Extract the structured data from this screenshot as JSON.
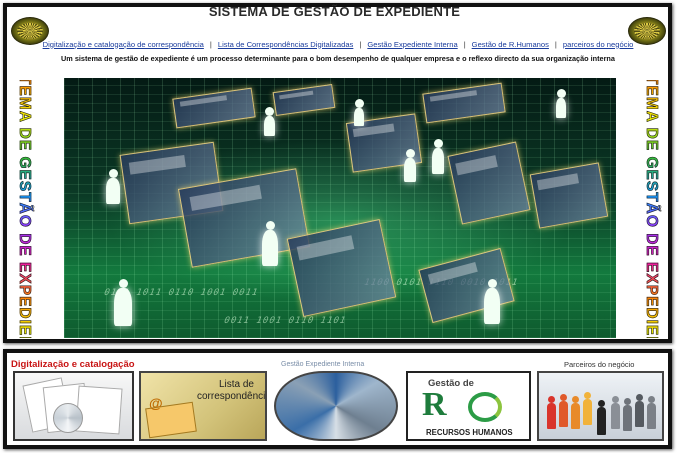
{
  "header": {
    "title": "SISTEMA DE GESTÃO DE EXPEDIENTE",
    "tagline": "Um sistema de gestão de expediente é um processo determinante para o bom desempenho de qualquer empresa e o reflexo directo da sua organização interna"
  },
  "nav": {
    "items": [
      {
        "label": "Digitalização e catalogação de correspondência"
      },
      {
        "label": "Lista de Correspondências Digitalizadas"
      },
      {
        "label": "Gestão Expediente Interna"
      },
      {
        "label": "Gestão de R.Humanos"
      },
      {
        "label": "parceiros do negócio"
      }
    ],
    "separator": "|"
  },
  "side_banner": {
    "text": "SISTEMA DE GESTÃO DE EXPEDIENTE"
  },
  "tiles": {
    "digitalizacao_label": "Digitalização e catalogação",
    "lista_text_1": "Lista de",
    "lista_text_2": "correspondências",
    "gestao_label": "Gestão Expediente Interna",
    "rh_gestao": "Gestão de",
    "rh_letters": "R",
    "rh_caption": "RECURSOS HUMANOS",
    "parceiros_label": "Parceiros do negócio"
  },
  "colors": {
    "nav_link": "#1a3c9c",
    "digitalizacao_label": "#c81414",
    "rh_green": "#1e7c3c",
    "hero_green": "#137a3e"
  },
  "icons": {
    "logo": "olive-emblem-icon"
  }
}
